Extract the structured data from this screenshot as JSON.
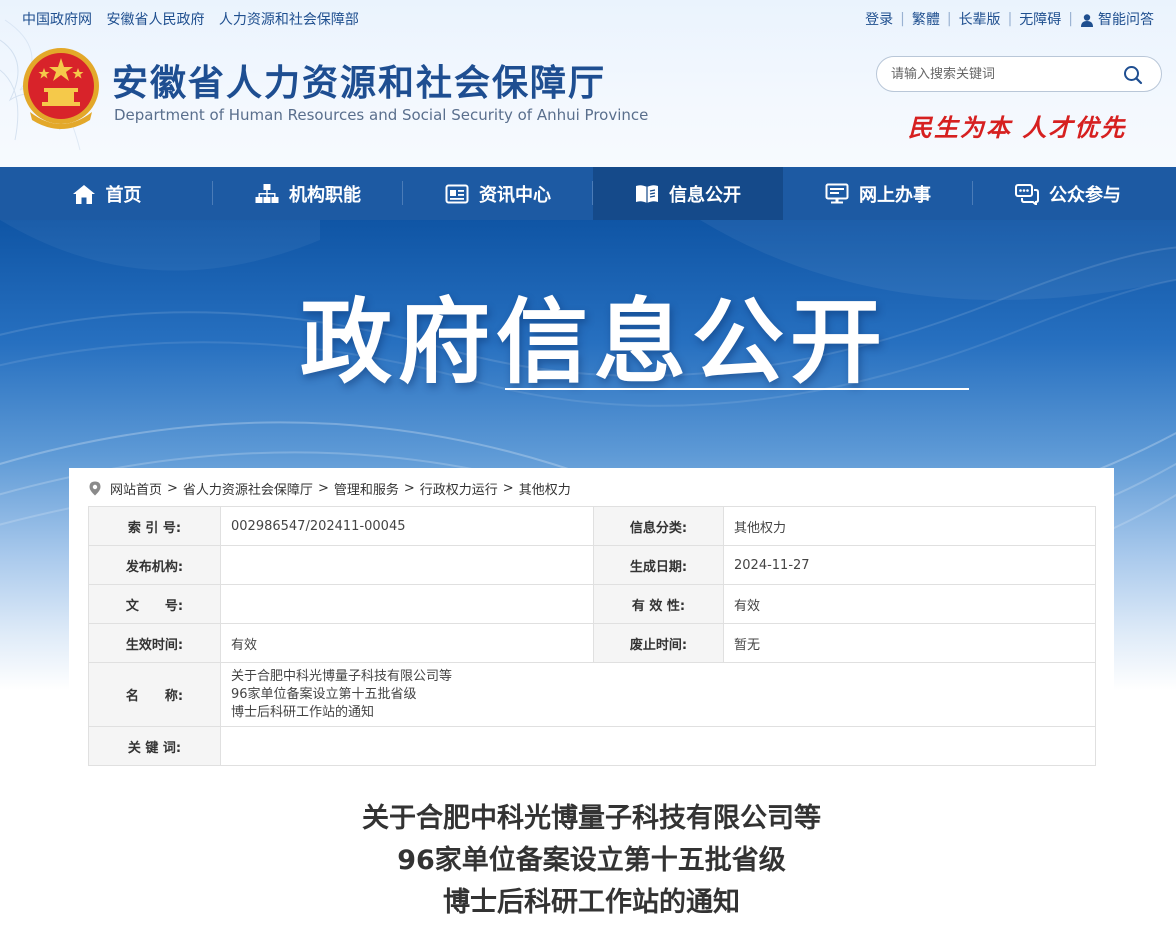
{
  "top_links": {
    "left": [
      "中国政府网",
      "安徽省人民政府",
      "人力资源和社会保障部"
    ],
    "right": [
      "登录",
      "繁體",
      "长辈版",
      "无障碍",
      "智能问答"
    ]
  },
  "header": {
    "title": "安徽省人力资源和社会保障厅",
    "subtitle": "Department of Human Resources and Social Security of Anhui Province",
    "search_placeholder": "请输入搜索关键词",
    "slogan": "民生为本 人才优先"
  },
  "nav": {
    "items": [
      {
        "label": "首页",
        "icon": "home-icon"
      },
      {
        "label": "机构职能",
        "icon": "org-icon"
      },
      {
        "label": "资讯中心",
        "icon": "news-icon"
      },
      {
        "label": "信息公开",
        "icon": "book-icon",
        "active": true
      },
      {
        "label": "网上办事",
        "icon": "monitor-icon"
      },
      {
        "label": "公众参与",
        "icon": "chat-icon"
      }
    ]
  },
  "banner": {
    "title": "政府信息公开"
  },
  "breadcrumb": [
    "网站首页",
    "省人力资源社会保障厅",
    "管理和服务",
    "行政权力运行",
    "其他权力"
  ],
  "info": {
    "index_label": "索 引 号:",
    "index_value": "002986547/202411-00045",
    "category_label": "信息分类:",
    "category_value": "其他权力",
    "publisher_label": "发布机构:",
    "publisher_value": "",
    "date_label": "生成日期:",
    "date_value": "2024-11-27",
    "docno_label": "文　　号:",
    "docno_value": "",
    "validity_label": "有 效 性:",
    "validity_value": "有效",
    "effective_label": "生效时间:",
    "effective_value": "有效",
    "abolish_label": "废止时间:",
    "abolish_value": "暂无",
    "name_label": "名　　称:",
    "name_lines": [
      "关于合肥中科光博量子科技有限公司等",
      "96家单位备案设立第十五批省级",
      "博士后科研工作站的通知"
    ],
    "keywords_label": "关 键 词:",
    "keywords_value": ""
  },
  "doc_title_lines": [
    "关于合肥中科光博量子科技有限公司等",
    "96家单位备案设立第十五批省级",
    "博士后科研工作站的通知"
  ],
  "colors": {
    "nav": "#1d5aa3",
    "nav_active": "#154a8a",
    "title": "#1e4e91",
    "slogan": "#d62020"
  }
}
